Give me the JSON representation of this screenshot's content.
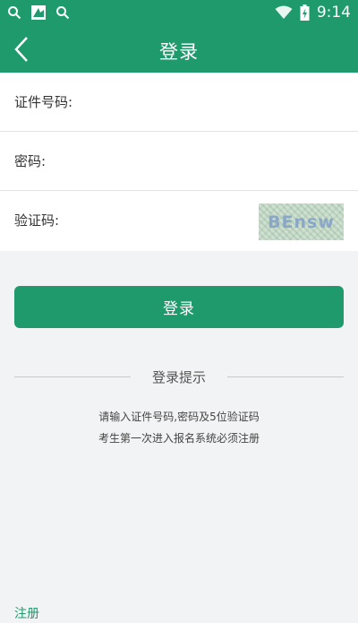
{
  "status_bar": {
    "time": "9:14",
    "icons": [
      "search-icon",
      "app-icon",
      "search-icon",
      "wifi-icon",
      "battery-icon"
    ]
  },
  "header": {
    "title": "登录",
    "back_icon": "chevron-left-icon"
  },
  "form": {
    "id_number_label": "证件号码:",
    "id_number_value": "",
    "password_label": "密码:",
    "password_value": "",
    "captcha_label": "验证码:",
    "captcha_value": "",
    "captcha_image_text": "BEnsw"
  },
  "login_button": {
    "label": "登录"
  },
  "hint": {
    "title": "登录提示",
    "line1": "请输入证件号码,密码及5位验证码",
    "line2": "考生第一次进入报名系统必须注册"
  },
  "footer": {
    "register_label": "注册"
  },
  "colors": {
    "primary": "#1f9a6c",
    "background": "#f2f3f5"
  }
}
